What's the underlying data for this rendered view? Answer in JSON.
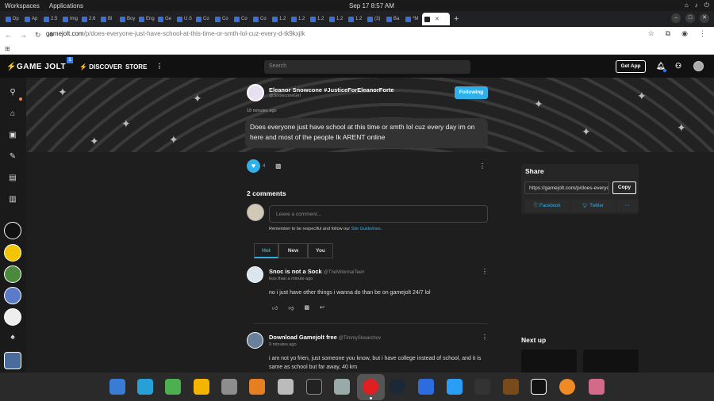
{
  "os": {
    "menu": [
      "Workspaces",
      "Applications"
    ],
    "clock": "Sep 17   8:57 AM"
  },
  "tabs": [
    "Dp",
    "Ap",
    "2.5",
    "Img",
    "2.6",
    "Bl",
    "Boy",
    "Eng",
    "Ge",
    "U.S",
    "Co",
    "Co",
    "Co",
    "Co",
    "1.2",
    "1.2",
    "1.2",
    "1.2",
    "1.2",
    "(3)",
    "Ba",
    "*M",
    ""
  ],
  "browser": {
    "url_host": "gamejolt.com",
    "url_path": "/p/does-everyone-just-have-school-at-this-time-or-smth-lol-cuz-every-d-tk9kxjlk"
  },
  "nav": {
    "logo": "GAME JOLT",
    "badge": "1",
    "discover": "DISCOVER",
    "store": "STORE",
    "more": "⋮",
    "search_placeholder": "Search",
    "get_app": "Get App"
  },
  "post": {
    "author_name": "Eleanor Snowcone #JusticeForEleanorForte",
    "author_handle": "@SnowconeGirl",
    "follow_label": "Following",
    "time": "18 minutes ago",
    "body": "Does everyone just have school at this time or smth lol cuz every day im on here and most of the people Ik ARENT online",
    "like_count": "4"
  },
  "comments_section": {
    "count_label": "2 comments",
    "input_placeholder": "Leave a comment...",
    "guidelines_prefix": "Remember to be respectful and follow our ",
    "guidelines_link": "Site Guidelines",
    "guidelines_suffix": ".",
    "sort_tabs": [
      "Hot",
      "New",
      "You"
    ]
  },
  "comments": [
    {
      "name": "Snoc is not a Sock",
      "handle": "@TheMilonnaiTeen",
      "time": "less than a minute ago",
      "body": "no i just have other things i wanna do than be on gamejolt 24/7 lol"
    },
    {
      "name": "Download Gamejolt free",
      "handle": "@TimmySkwarchov",
      "time": "9 minutes ago",
      "body_line1": "i am not yo frien, just someone you know, but i have college instead of school, and it is",
      "body_line2": "same as school but far away, 40 km"
    }
  ],
  "share": {
    "title": "Share",
    "url": "https://gamejolt.com/p/does-everyone",
    "copy": "Copy",
    "facebook": "Facebook",
    "twitter": "Twitter",
    "more": "⋯"
  },
  "next_up": "Next up",
  "colors": {
    "accent": "#2fb0e9",
    "gj_blue": "#2f7fff"
  }
}
